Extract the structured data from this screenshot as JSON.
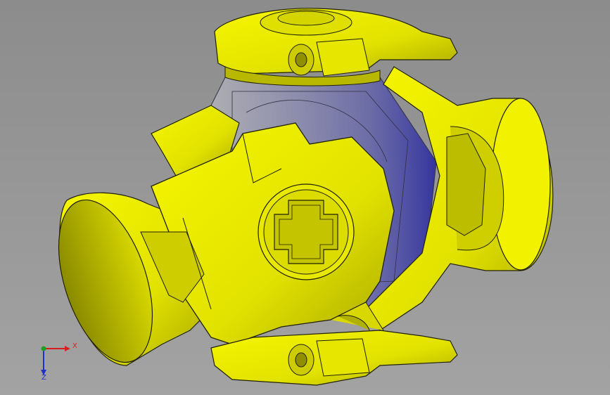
{
  "viewport": {
    "background_top": "#8c8c8c",
    "background_bottom": "#a3a3a3"
  },
  "model": {
    "part_color": "#ecec00",
    "part_shade": "#c9c900",
    "part_dark": "#8f8f00",
    "transparent_part_color": "#3a3aa8",
    "edge_color": "#202000"
  },
  "triad": {
    "x_label": "X",
    "y_label": "Y",
    "z_label": "Z",
    "x_color": "#d62020",
    "y_color": "#20a020",
    "z_color": "#2030c8"
  }
}
